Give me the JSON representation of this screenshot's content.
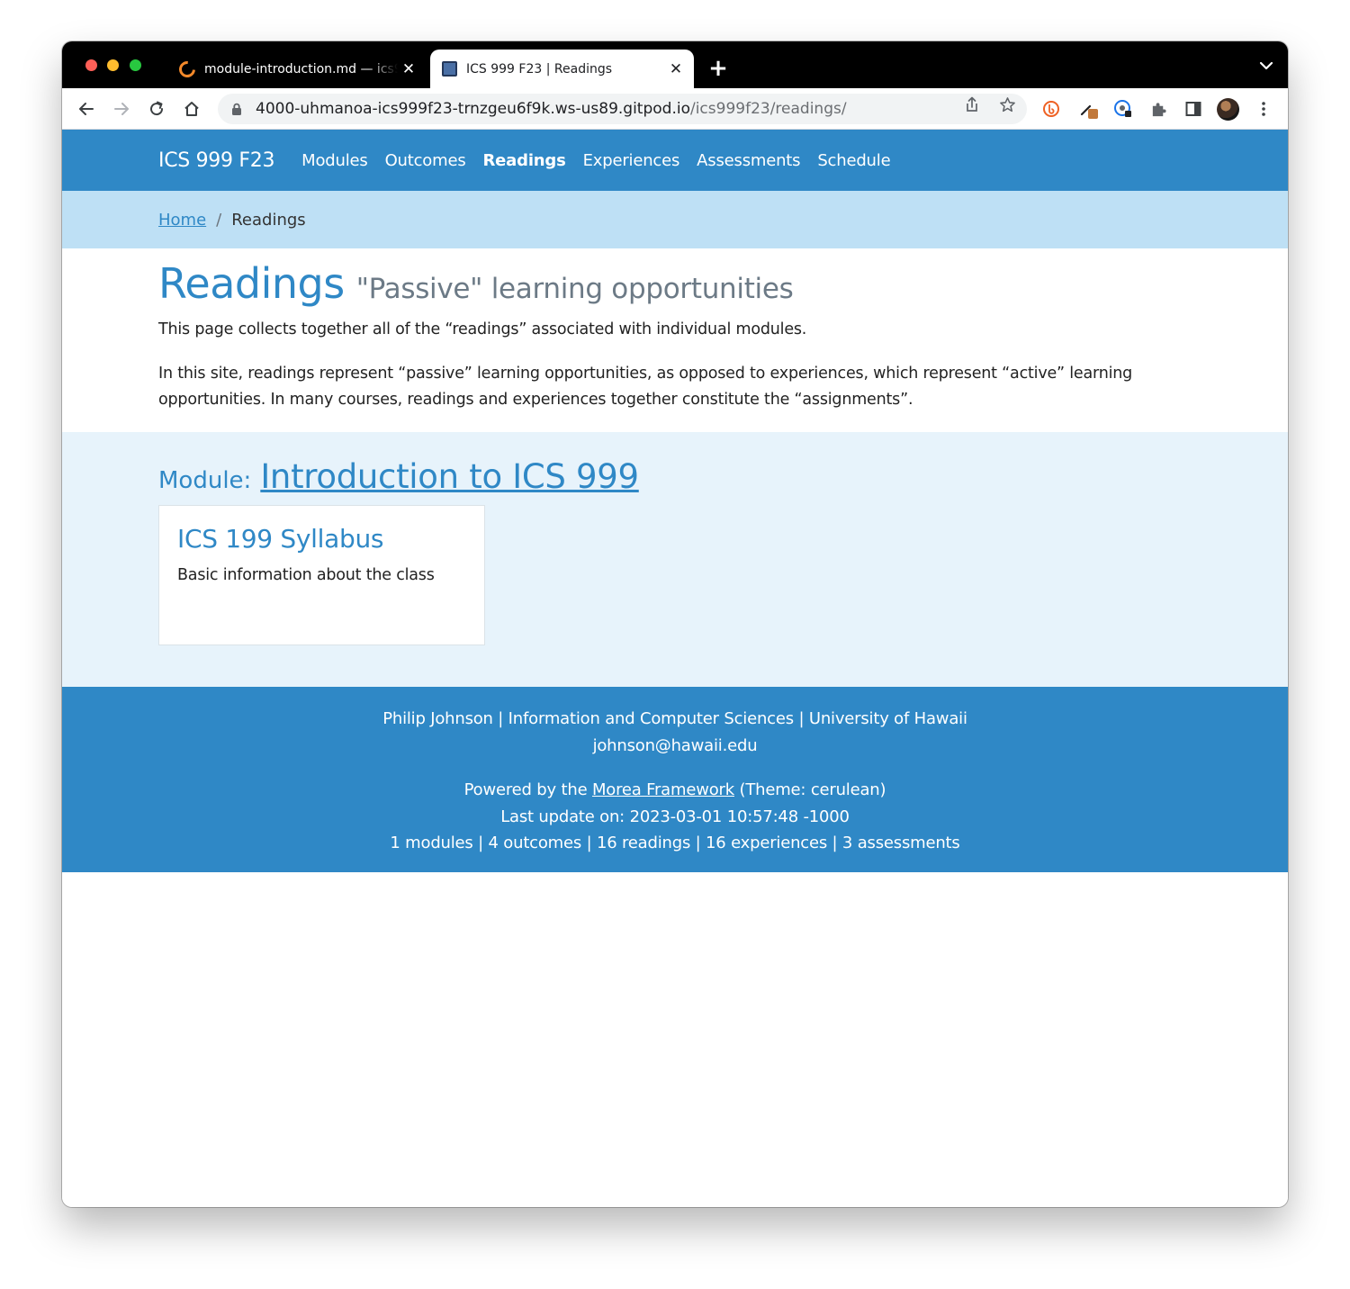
{
  "browser": {
    "tabs": [
      {
        "title": "module-introduction.md — ics999f23",
        "active": false,
        "favicon": "gitpod-icon"
      },
      {
        "title": "ICS 999 F23 | Readings",
        "active": true,
        "favicon": "page-icon"
      }
    ],
    "new_tab_label": "+",
    "close_label": "✕",
    "url_host": "4000-uhmanoa-ics999f23-trnzgeu6f9k.ws-us89.gitpod.io",
    "url_path": "/ics999f23/readings/"
  },
  "navbar": {
    "brand": "ICS 999 F23",
    "links": [
      {
        "label": "Modules",
        "active": false
      },
      {
        "label": "Outcomes",
        "active": false
      },
      {
        "label": "Readings",
        "active": true
      },
      {
        "label": "Experiences",
        "active": false
      },
      {
        "label": "Assessments",
        "active": false
      },
      {
        "label": "Schedule",
        "active": false
      }
    ]
  },
  "breadcrumb": {
    "home": "Home",
    "separator": "/",
    "current": "Readings"
  },
  "intro": {
    "title": "Readings",
    "subtitle": "\"Passive\" learning opportunities",
    "paragraph1": "This page collects together all of the “readings” associated with individual modules.",
    "paragraph2": "In this site, readings represent “passive” learning opportunities, as opposed to experiences, which represent “active” learning opportunities. In many courses, readings and experiences together constitute the “assignments”."
  },
  "module": {
    "prefix": "Module:",
    "name": "Introduction to ICS 999",
    "readings": [
      {
        "title": "ICS 199 Syllabus",
        "description": "Basic information about the class"
      }
    ]
  },
  "footer": {
    "credits": "Philip Johnson | Information and Computer Sciences | University of Hawaii",
    "email": "johnson@hawaii.edu",
    "powered_prefix": "Powered by the ",
    "powered_link": "Morea Framework",
    "powered_suffix": " (Theme: cerulean)",
    "last_update": "Last update on: 2023-03-01 10:57:48 -1000",
    "stats": "1 modules | 4 outcomes | 16 readings | 16 experiences | 3 assessments"
  },
  "colors": {
    "primary": "#2f88c6",
    "breadcrumb_bg": "#bee0f5",
    "section_bg": "#e7f3fb",
    "subtitle": "#6c7a86"
  }
}
